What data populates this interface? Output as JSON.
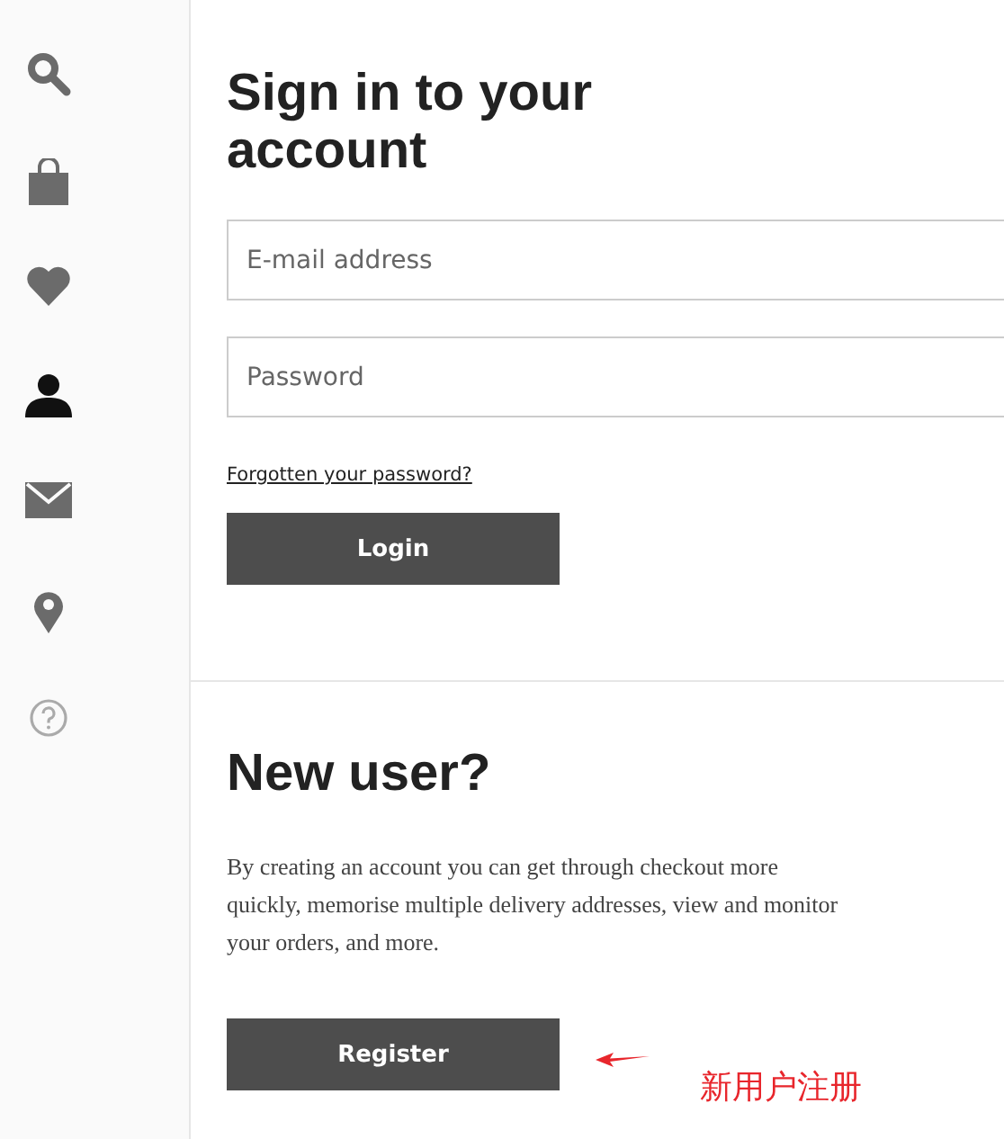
{
  "sidebar": {
    "items": [
      {
        "selected": false
      },
      {
        "selected": false
      },
      {
        "selected": false
      },
      {
        "selected": true
      },
      {
        "selected": false
      },
      {
        "selected": false
      },
      {
        "selected": false
      }
    ]
  },
  "sign_in": {
    "title": "Sign in to your account",
    "fields": [
      {
        "placeholder": "E-mail address"
      },
      {
        "placeholder": "Password"
      }
    ],
    "forgot_link": "Forgotten your password?",
    "button": "Login"
  },
  "new_user": {
    "title": "New user?",
    "description": "By creating an account you can get through checkout more quickly, memorise multiple delivery addresses, view and monitor your orders, and more.",
    "button": "Register"
  },
  "annotation": {
    "text": "新用户注册"
  }
}
